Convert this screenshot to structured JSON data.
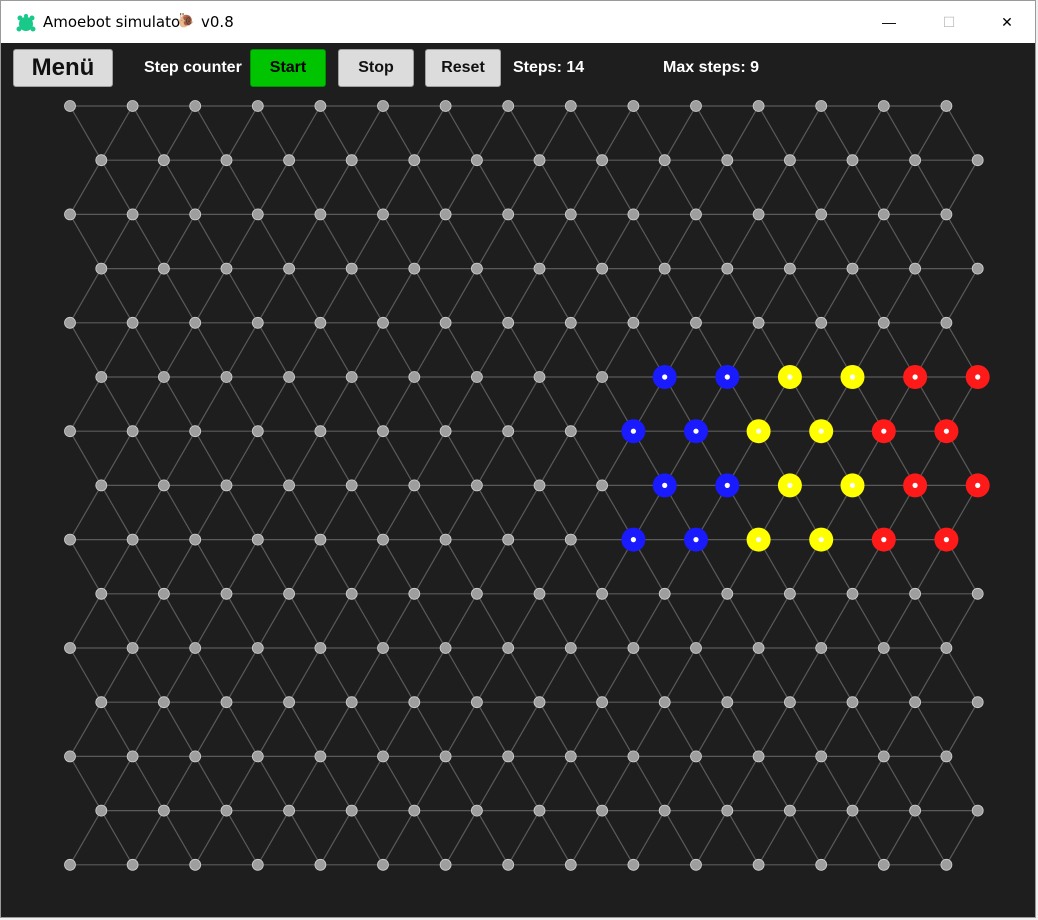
{
  "window": {
    "title": "Amoebot simulator",
    "title_icon": "snail-icon",
    "version": "v0.8",
    "controls": {
      "minimize": "—",
      "maximize": "☐",
      "close": "✕"
    }
  },
  "toolbar": {
    "menu_label": "Menü",
    "step_counter_label": "Step counter",
    "start_label": "Start",
    "stop_label": "Stop",
    "reset_label": "Reset",
    "steps_text": "Steps: 14",
    "max_steps_text": "Max steps: 9"
  },
  "colors": {
    "background": "#1e1e1e",
    "grid_line": "#5a5a5a",
    "empty_node": "#9e9e9e",
    "start_button": "#00c400",
    "blue": "#1a1aff",
    "yellow": "#ffff00",
    "red": "#ff1a1a"
  },
  "grid": {
    "rows": 15,
    "cols": 15,
    "particles": [
      {
        "row": 5,
        "col": 9,
        "color": "blue"
      },
      {
        "row": 5,
        "col": 10,
        "color": "blue"
      },
      {
        "row": 5,
        "col": 11,
        "color": "yellow"
      },
      {
        "row": 5,
        "col": 12,
        "color": "yellow"
      },
      {
        "row": 5,
        "col": 13,
        "color": "red"
      },
      {
        "row": 5,
        "col": 14,
        "color": "red"
      },
      {
        "row": 6,
        "col": 9,
        "color": "blue"
      },
      {
        "row": 6,
        "col": 10,
        "color": "blue"
      },
      {
        "row": 6,
        "col": 11,
        "color": "yellow"
      },
      {
        "row": 6,
        "col": 12,
        "color": "yellow"
      },
      {
        "row": 6,
        "col": 13,
        "color": "red"
      },
      {
        "row": 6,
        "col": 14,
        "color": "red"
      },
      {
        "row": 7,
        "col": 9,
        "color": "blue"
      },
      {
        "row": 7,
        "col": 10,
        "color": "blue"
      },
      {
        "row": 7,
        "col": 11,
        "color": "yellow"
      },
      {
        "row": 7,
        "col": 12,
        "color": "yellow"
      },
      {
        "row": 7,
        "col": 13,
        "color": "red"
      },
      {
        "row": 7,
        "col": 14,
        "color": "red"
      },
      {
        "row": 8,
        "col": 9,
        "color": "blue"
      },
      {
        "row": 8,
        "col": 10,
        "color": "blue"
      },
      {
        "row": 8,
        "col": 11,
        "color": "yellow"
      },
      {
        "row": 8,
        "col": 12,
        "color": "yellow"
      },
      {
        "row": 8,
        "col": 13,
        "color": "red"
      },
      {
        "row": 8,
        "col": 14,
        "color": "red"
      }
    ]
  }
}
